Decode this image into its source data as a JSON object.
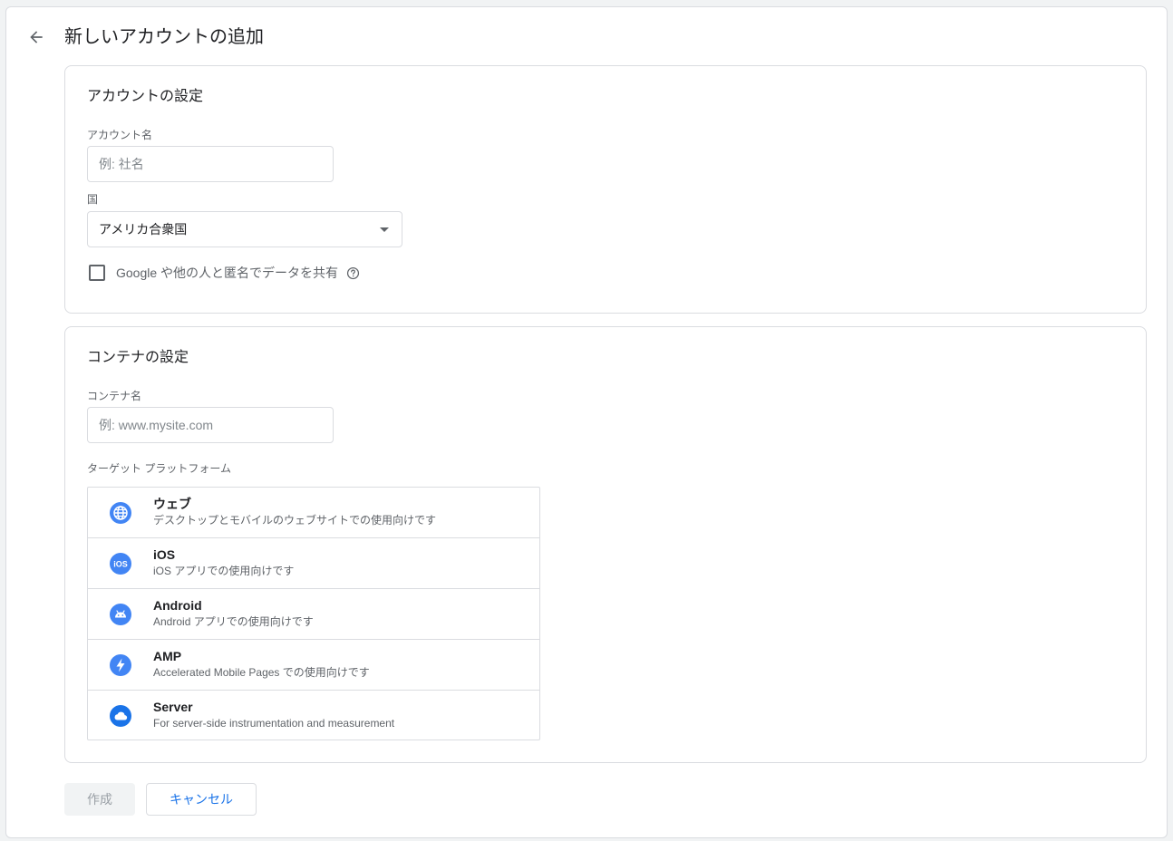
{
  "header": {
    "title": "新しいアカウントの追加"
  },
  "account_section": {
    "title": "アカウントの設定",
    "account_name_label": "アカウント名",
    "account_name_placeholder": "例: 社名",
    "account_name_value": "",
    "country_label": "国",
    "country_value": "アメリカ合衆国",
    "share_data_label": "Google や他の人と匿名でデータを共有",
    "share_data_checked": false
  },
  "container_section": {
    "title": "コンテナの設定",
    "container_name_label": "コンテナ名",
    "container_name_placeholder": "例: www.mysite.com",
    "container_name_value": "",
    "platform_label": "ターゲット プラットフォーム",
    "platforms": [
      {
        "name": "ウェブ",
        "description": "デスクトップとモバイルのウェブサイトでの使用向けです",
        "icon": "globe-icon"
      },
      {
        "name": "iOS",
        "description": "iOS アプリでの使用向けです",
        "icon": "ios-icon"
      },
      {
        "name": "Android",
        "description": "Android アプリでの使用向けです",
        "icon": "android-icon"
      },
      {
        "name": "AMP",
        "description": "Accelerated Mobile Pages での使用向けです",
        "icon": "amp-icon"
      },
      {
        "name": "Server",
        "description": "For server-side instrumentation and measurement",
        "icon": "cloud-icon"
      }
    ]
  },
  "actions": {
    "create_label": "作成",
    "cancel_label": "キャンセル"
  },
  "colors": {
    "accent": "#1a73e8",
    "icon_blue": "#4285f4",
    "border": "#dadce0"
  }
}
